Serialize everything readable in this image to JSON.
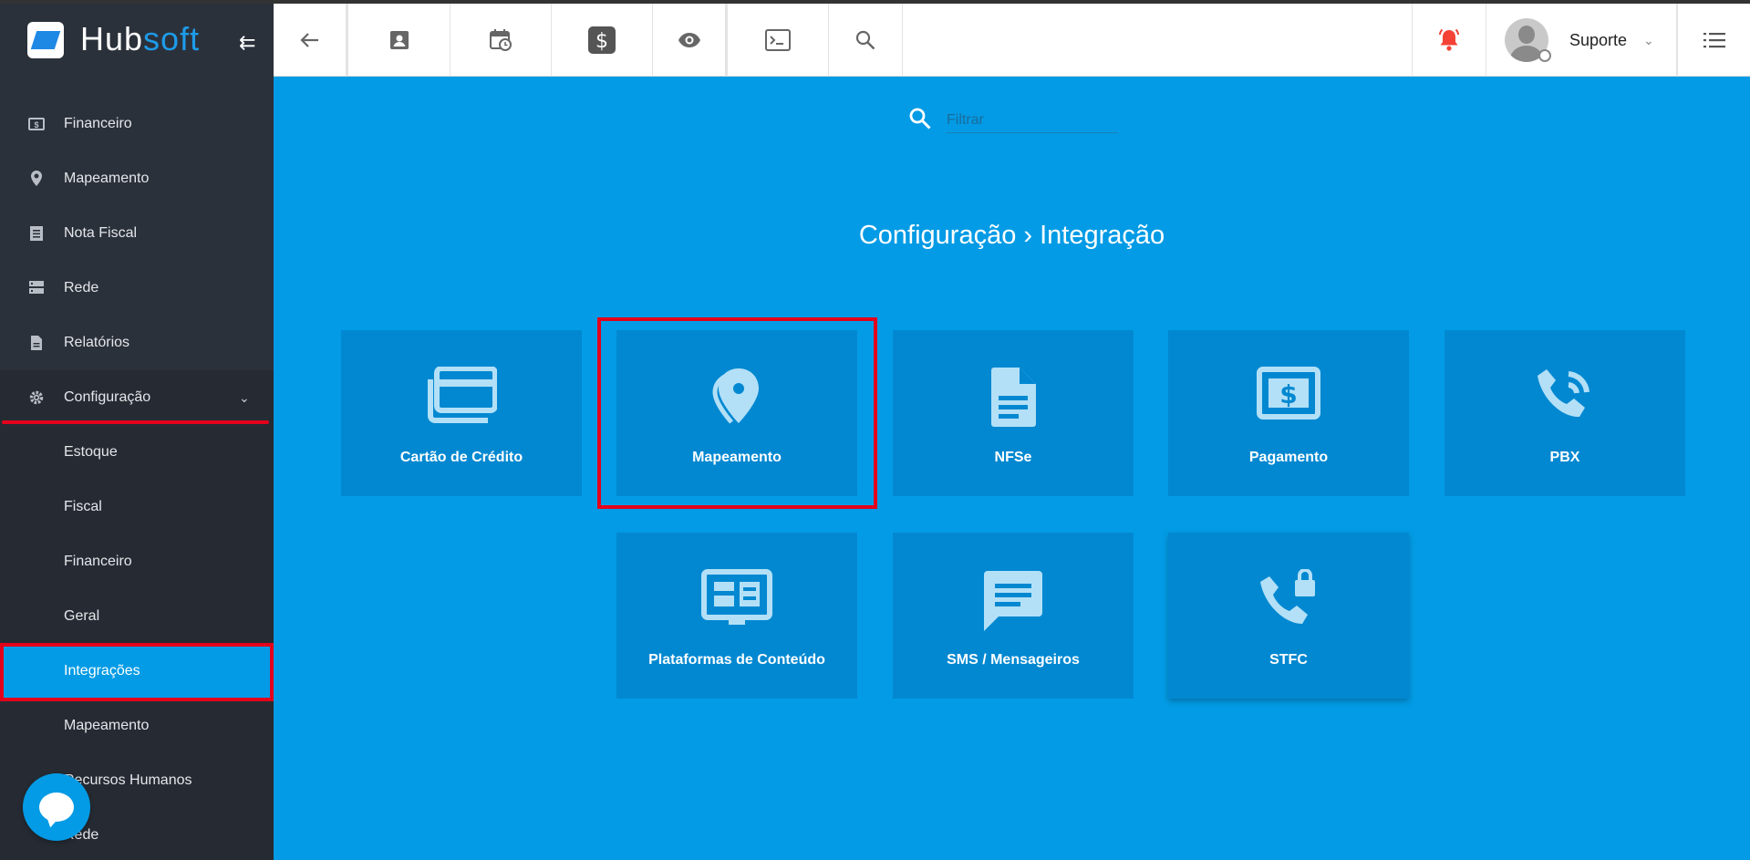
{
  "brand": {
    "name_a": "Hub",
    "name_b": "soft"
  },
  "sidebar": {
    "items": [
      {
        "label": "Financeiro",
        "icon": "money-icon"
      },
      {
        "label": "Mapeamento",
        "icon": "map-pin-icon"
      },
      {
        "label": "Nota Fiscal",
        "icon": "document-list-icon"
      },
      {
        "label": "Rede",
        "icon": "network-icon"
      },
      {
        "label": "Relatórios",
        "icon": "report-icon"
      },
      {
        "label": "Configuração",
        "icon": "gear-icon"
      }
    ],
    "subitems": [
      {
        "label": "Estoque"
      },
      {
        "label": "Fiscal"
      },
      {
        "label": "Financeiro"
      },
      {
        "label": "Geral"
      },
      {
        "label": "Integrações"
      },
      {
        "label": "Mapeamento"
      },
      {
        "label": "Recursos Humanos"
      },
      {
        "label": "Rede"
      }
    ]
  },
  "topbar": {
    "user_name": "Suporte",
    "icons": [
      "back-arrow-icon",
      "contact-card-icon",
      "calendar-clock-icon",
      "dollar-icon",
      "eye-icon",
      "terminal-icon",
      "search-icon",
      "bell-icon",
      "chevron-down-icon",
      "menu-list-icon"
    ],
    "alert_color": "#f44336"
  },
  "main": {
    "filter_placeholder": "Filtrar",
    "title": "Configuração › Integração",
    "tiles": [
      {
        "label": "Cartão de Crédito",
        "icon": "credit-card-icon"
      },
      {
        "label": "Mapeamento",
        "icon": "map-pin-icon"
      },
      {
        "label": "NFSe",
        "icon": "document-icon"
      },
      {
        "label": "Pagamento",
        "icon": "money-bill-icon"
      },
      {
        "label": "PBX",
        "icon": "phone-call-icon"
      },
      {
        "label": "Plataformas de Conteúdo",
        "icon": "dashboard-screen-icon"
      },
      {
        "label": "SMS / Mensageiros",
        "icon": "message-icon"
      },
      {
        "label": "STFC",
        "icon": "phone-lock-icon"
      }
    ]
  },
  "colors": {
    "accent": "#039be5",
    "tile": "#0288d1",
    "sidebar": "#2b313b",
    "annotation": "#e4001b"
  }
}
